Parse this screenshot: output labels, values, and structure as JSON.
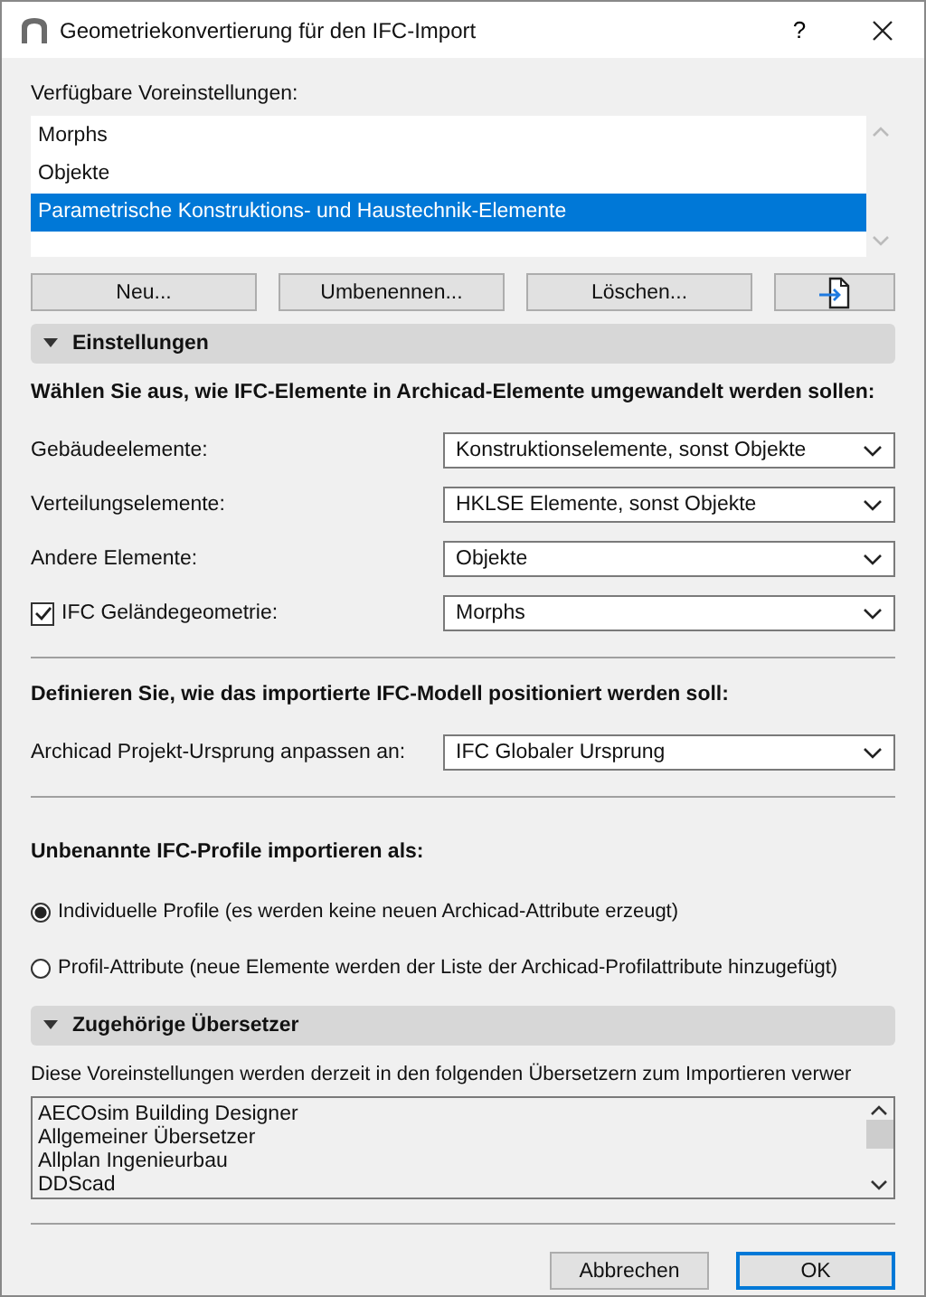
{
  "window": {
    "title": "Geometriekonvertierung für den IFC-Import",
    "help": "?"
  },
  "presets": {
    "label": "Verfügbare Voreinstellungen:",
    "items": [
      {
        "text": "Morphs",
        "selected": false
      },
      {
        "text": "Objekte",
        "selected": false
      },
      {
        "text": "Parametrische Konstruktions- und Haustechnik-Elemente",
        "selected": true
      }
    ]
  },
  "preset_buttons": [
    "Neu...",
    "Umbenennen...",
    "Löschen..."
  ],
  "settings": {
    "title": "Einstellungen",
    "expanded": true,
    "groups": [
      {
        "heading": "Wählen Sie aus, wie IFC-Elemente in Archicad-Elemente umgewandelt werden sollen:",
        "rows": [
          {
            "kind": "plain",
            "label": "Gebäudeelemente:",
            "value": "Konstruktionselemente, sonst Objekte"
          },
          {
            "kind": "plain",
            "label": "Verteilungselemente:",
            "value": "HKLSE Elemente, sonst Objekte"
          },
          {
            "kind": "plain",
            "label": "Andere Elemente:",
            "value": "Objekte"
          },
          {
            "kind": "checkbox",
            "label": "IFC Geländegeometrie:",
            "checked": true,
            "value": "Morphs"
          }
        ]
      },
      {
        "heading": "Definieren Sie, wie das importierte IFC-Modell positioniert werden soll:",
        "rows": [
          {
            "kind": "plain",
            "label": "Archicad Projekt-Ursprung anpassen an:",
            "value": "IFC Globaler Ursprung"
          }
        ]
      }
    ],
    "profiles": {
      "heading": "Unbenannte IFC-Profile importieren als:",
      "options": [
        {
          "text": "Individuelle Profile (es werden keine neuen Archicad-Attribute erzeugt)",
          "selected": true
        },
        {
          "text": "Profil-Attribute (neue Elemente werden der Liste der Archicad-Profilattribute hinzugefügt)",
          "selected": false
        }
      ]
    }
  },
  "translators": {
    "title": "Zugehörige Übersetzer",
    "expanded": true,
    "description": "Diese Voreinstellungen werden derzeit in den folgenden Übersetzern zum Importieren verwer",
    "items": [
      "AECOsim Building Designer",
      "Allgemeiner Übersetzer",
      "Allplan Ingenieurbau",
      "DDScad"
    ]
  },
  "footer_buttons": [
    {
      "label": "Abbrechen",
      "default": false
    },
    {
      "label": "OK",
      "default": true
    }
  ]
}
